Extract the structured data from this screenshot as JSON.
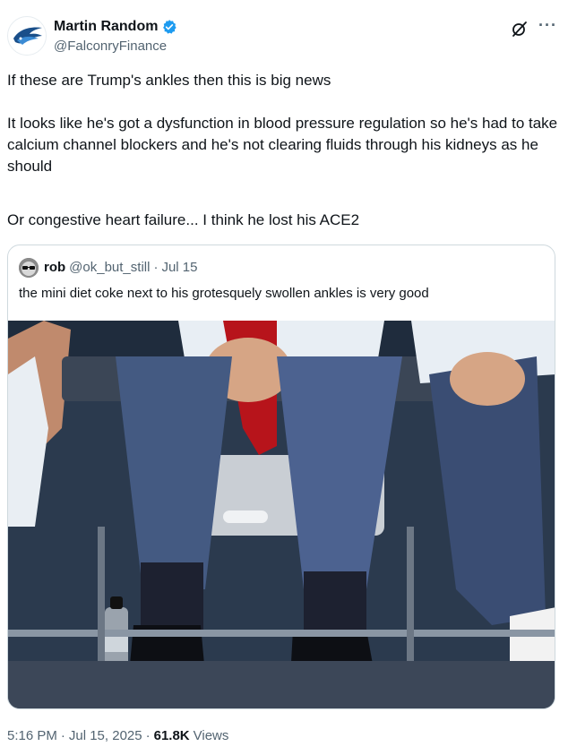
{
  "author": {
    "display_name": "Martin Random",
    "handle": "@FalconryFinance",
    "verified": true,
    "avatar_icon": "falcon-logo-icon"
  },
  "tweet": {
    "paragraphs": [
      "If these are Trump's ankles then this is big news",
      "It looks like he's got a dysfunction in blood pressure regulation so he's had to take calcium channel blockers and he's not clearing fluids through his kidneys as he should",
      "Or congestive heart failure... I think he lost his ACE2"
    ]
  },
  "quoted": {
    "display_name": "rob",
    "handle": "@ok_but_still",
    "separator": "·",
    "date": "Jul 15",
    "text": "the mini diet coke next to his grotesquely swollen ankles is very good",
    "media_icon": "photo-seated-men-ankles"
  },
  "footer": {
    "time": "5:16 PM",
    "separator1": "·",
    "date": "Jul 15, 2025",
    "separator2": "·",
    "views_count": "61.8K",
    "views_label": "Views"
  },
  "colors": {
    "text": "#0f1419",
    "secondary": "#536471",
    "verified": "#1d9bf0",
    "border": "#cfd9de"
  }
}
